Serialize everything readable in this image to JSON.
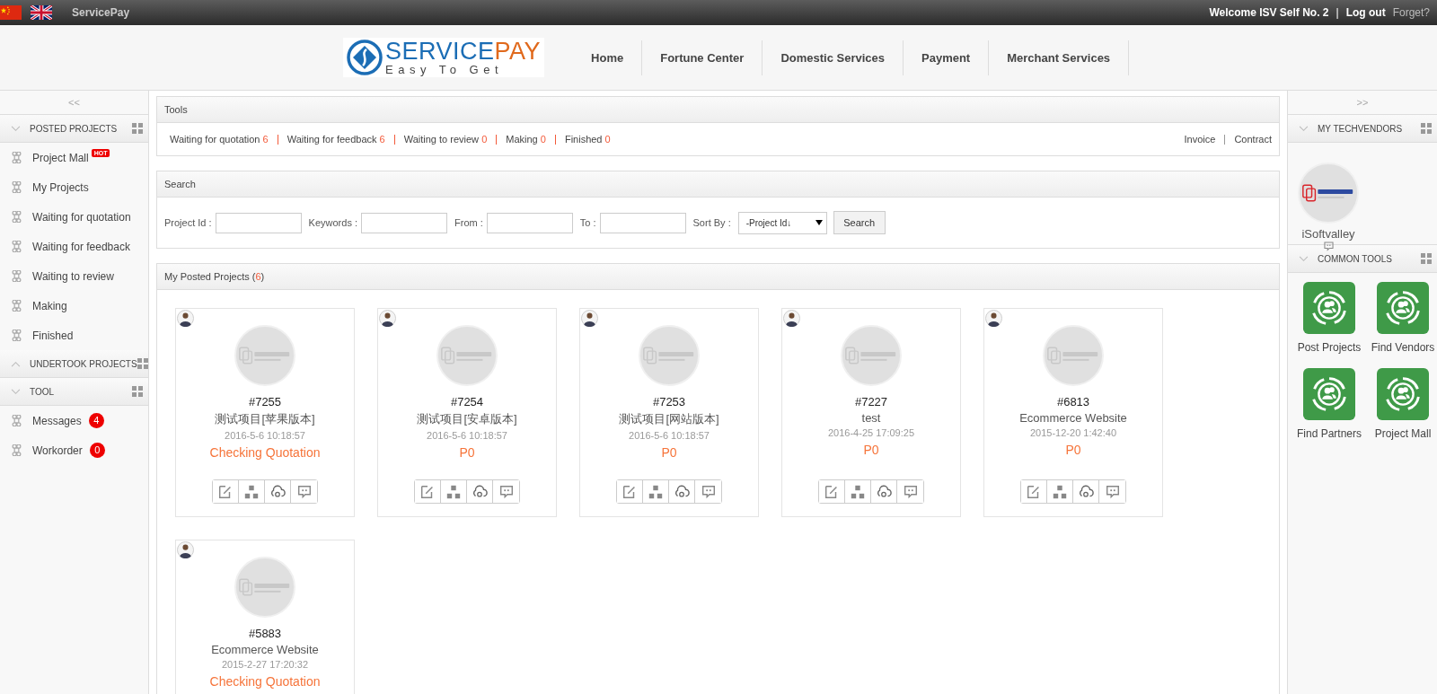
{
  "top_bar": {
    "site_name": "ServicePay",
    "welcome": "Welcome ISV Self No. 2",
    "separator": "|",
    "logout": "Log out",
    "forget": "Forget?"
  },
  "header": {
    "logo": {
      "wordmark": "SERVICE",
      "wordmark_accent": "PAY",
      "tagline": "Easy To Get"
    },
    "nav": [
      "Home",
      "Fortune Center",
      "Domestic Services",
      "Payment",
      "Merchant Services"
    ]
  },
  "left_sidebar": {
    "collapse": "<<",
    "sections": [
      {
        "title": "POSTED PROJECTS",
        "expanded": true,
        "items": [
          {
            "label": "Project Mall",
            "badge": "HOT"
          },
          {
            "label": "My Projects"
          },
          {
            "label": "Waiting for quotation"
          },
          {
            "label": "Waiting for feedback"
          },
          {
            "label": "Waiting to review"
          },
          {
            "label": "Making"
          },
          {
            "label": "Finished"
          }
        ]
      },
      {
        "title": "UNDERTOOK PROJECTS",
        "expanded": false
      },
      {
        "title": "TOOL",
        "expanded": true,
        "items": [
          {
            "label": "Messages",
            "count": "4"
          },
          {
            "label": "Workorder",
            "count": "0"
          }
        ]
      }
    ]
  },
  "tools_panel": {
    "title": "Tools",
    "filters": [
      {
        "label": "Waiting for quotation",
        "count": "6"
      },
      {
        "label": "Waiting for feedback",
        "count": "6"
      },
      {
        "label": "Waiting to review",
        "count": "0"
      },
      {
        "label": "Making",
        "count": "0"
      },
      {
        "label": "Finished",
        "count": "0"
      }
    ],
    "links": [
      "Invoice",
      "Contract"
    ]
  },
  "search_panel": {
    "title": "Search",
    "fields": [
      {
        "label": "Project Id :"
      },
      {
        "label": "Keywords :"
      },
      {
        "label": "From :"
      },
      {
        "label": "To :"
      }
    ],
    "sort_label": "Sort By :",
    "sort_value": "-Project Id↓",
    "button": "Search"
  },
  "projects_panel": {
    "title": "My Posted Projects",
    "count_open": "(",
    "count": "6",
    "count_close": ")",
    "projects": [
      {
        "id": "#7255",
        "name": "测试项目[苹果版本]",
        "date": "2016-5-6 10:18:57",
        "status": "Checking Quotation"
      },
      {
        "id": "#7254",
        "name": "测试项目[安卓版本]",
        "date": "2016-5-6 10:18:57",
        "status": "P0"
      },
      {
        "id": "#7253",
        "name": "测试项目[网站版本]",
        "date": "2016-5-6 10:18:57",
        "status": "P0"
      },
      {
        "id": "#7227",
        "name": "test",
        "date": "2016-4-25 17:09:25",
        "status": "P0"
      },
      {
        "id": "#6813",
        "name": "Ecommerce Website",
        "date": "2015-12-20 1:42:40",
        "status": "P0"
      },
      {
        "id": "#5883",
        "name": "Ecommerce Website",
        "date": "2015-2-27 17:20:32",
        "status": "Checking Quotation"
      }
    ]
  },
  "right_sidebar": {
    "expand": ">>",
    "vendors_title": "MY TECHVENDORS",
    "vendors_expanded": true,
    "vendors": [
      {
        "name": "iSoftvalley"
      }
    ],
    "tools_title": "COMMON TOOLS",
    "tools_expanded": true,
    "tools": [
      "Post Projects",
      "Find Vendors",
      "Find Partners",
      "Project Mall"
    ]
  }
}
